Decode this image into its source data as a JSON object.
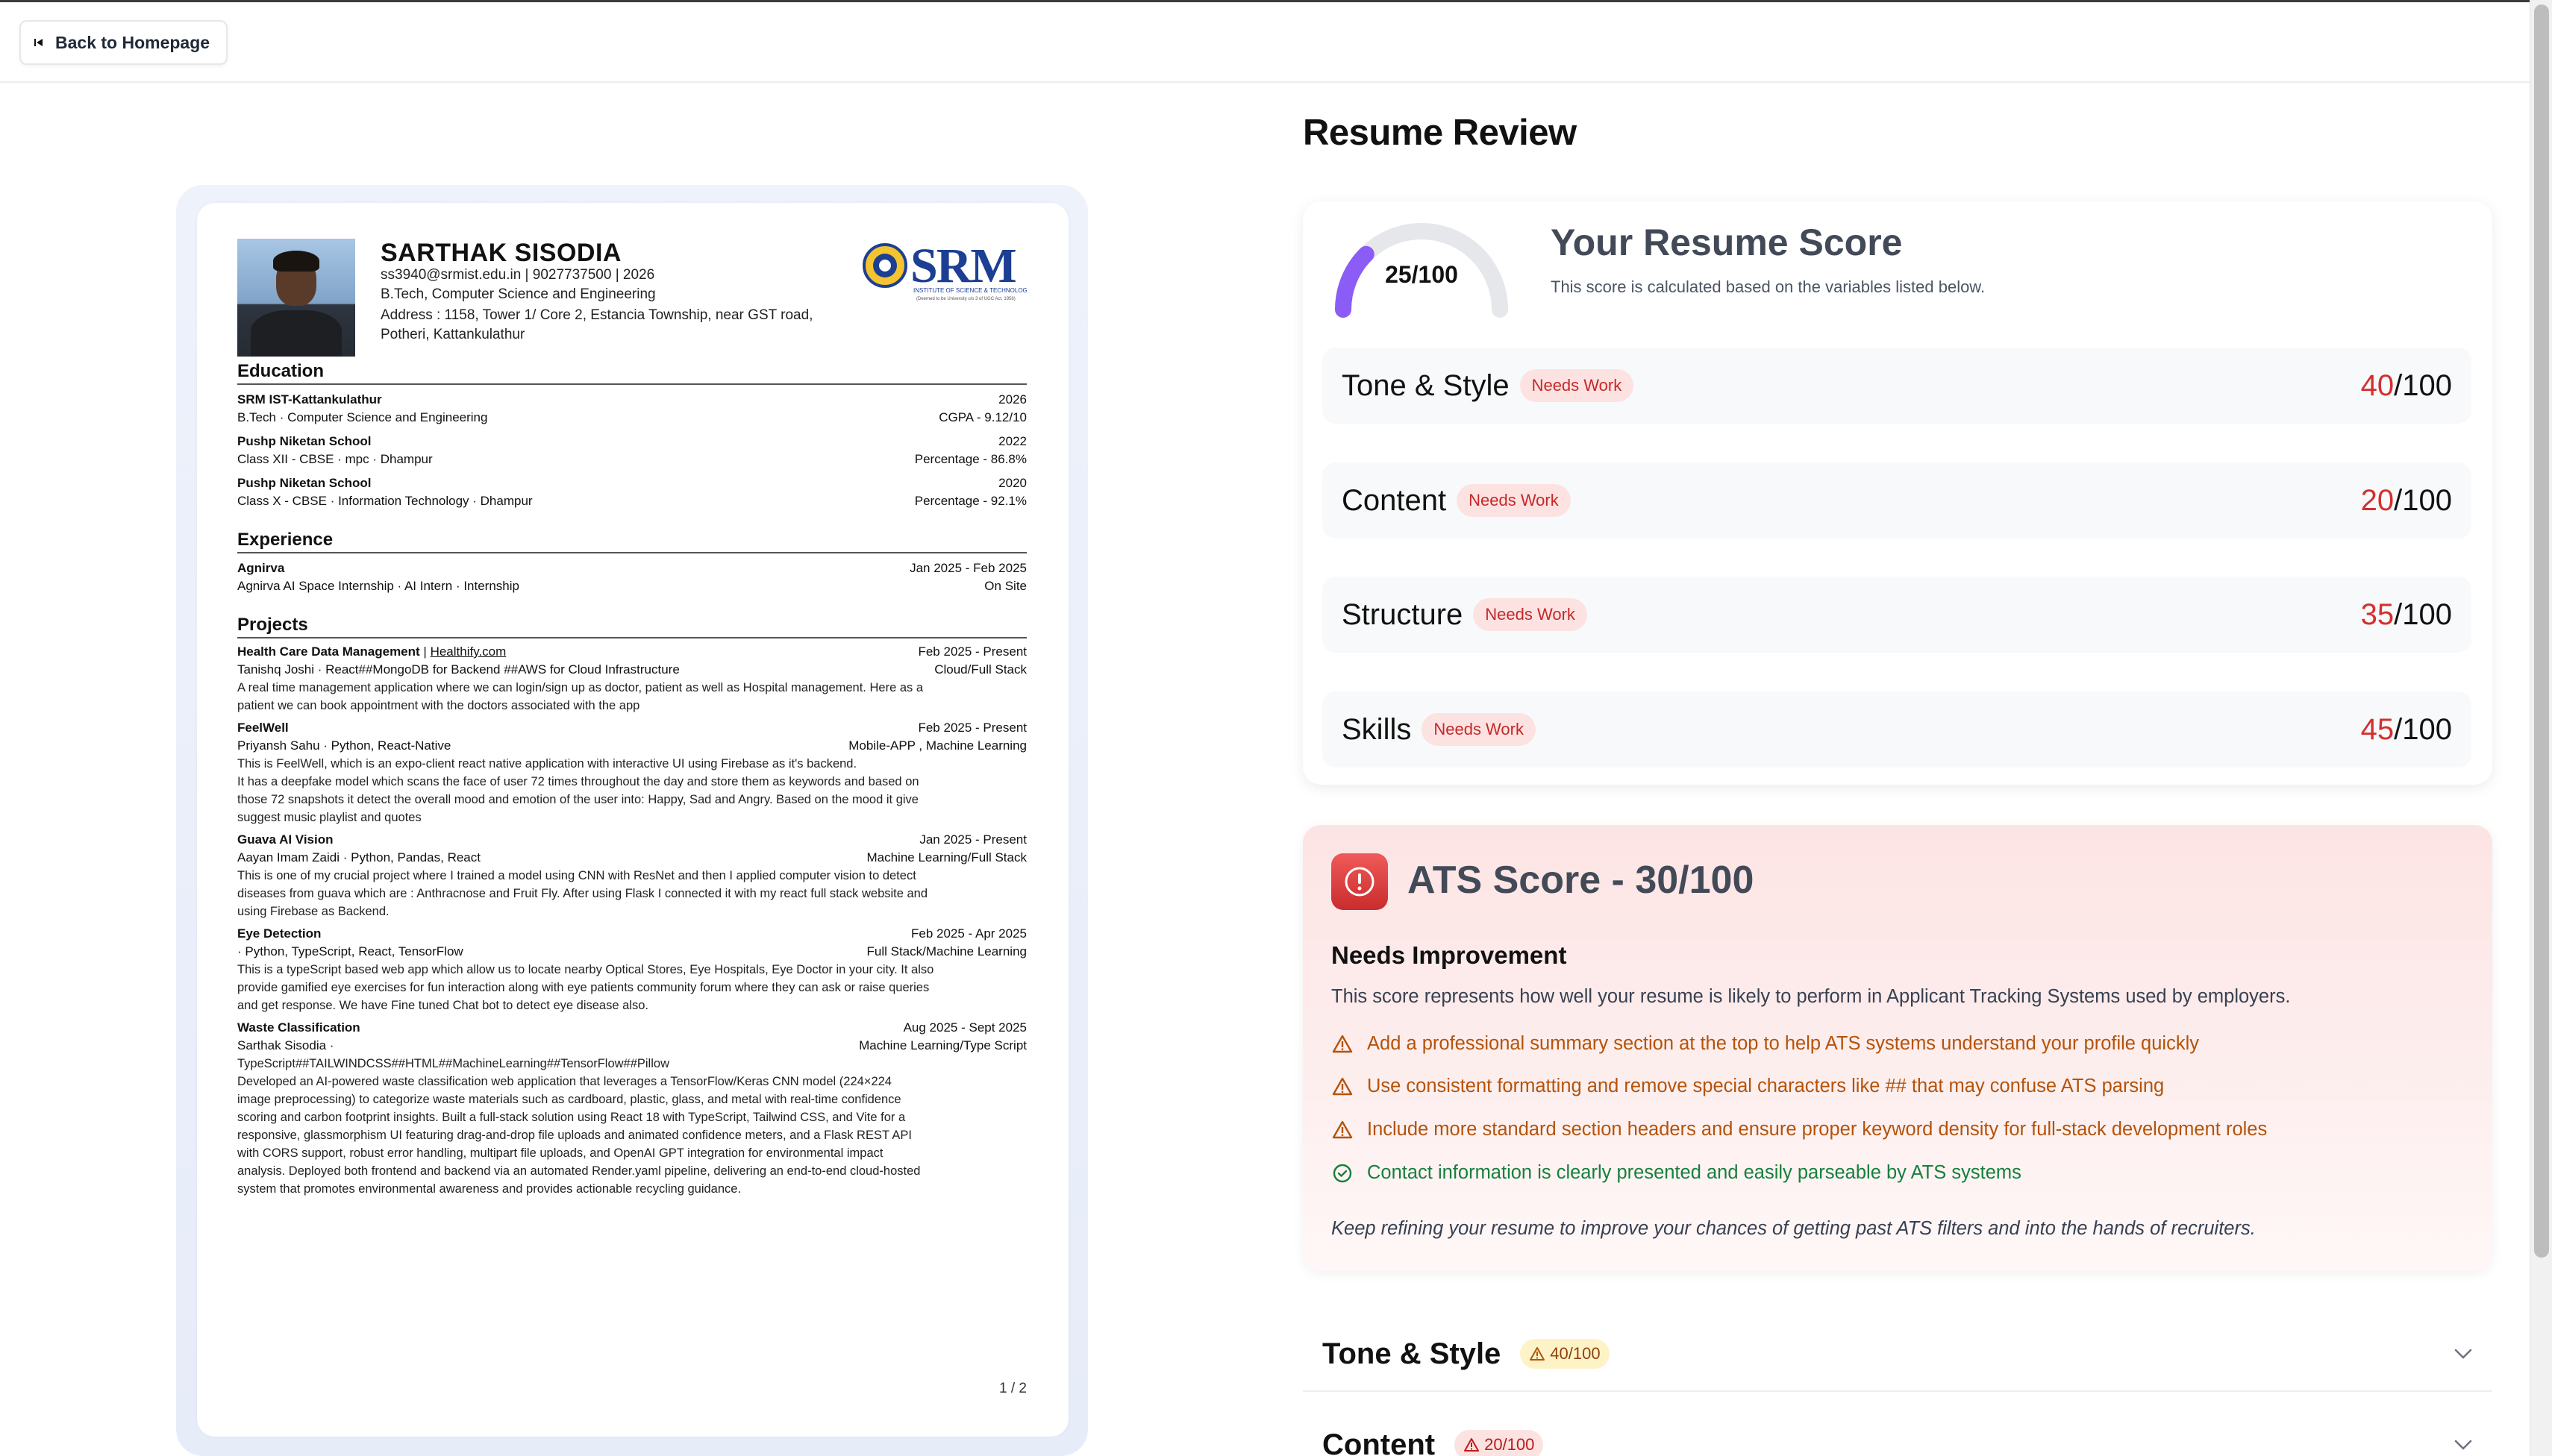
{
  "topbar": {
    "back_label": "Back to Homepage"
  },
  "resume": {
    "name": "SARTHAK SISODIA",
    "contact": "ss3940@srmist.edu.in   |   9027737500   |   2026",
    "degree": "B.Tech, Computer Science and Engineering",
    "address1": "Address : 1158, Tower 1/ Core 2, Estancia Township, near GST road,",
    "address2": "Potheri, Kattankulathur",
    "logo_text": "SRM",
    "logo_sub": "INSTITUTE OF SCIENCE & TECHNOLOGY",
    "logo_sub2": "(Deemed to be University u/s 3 of UGC Act, 1956)",
    "sections": {
      "education": "Education",
      "experience": "Experience",
      "projects": "Projects"
    },
    "education": [
      {
        "school": "SRM IST-Kattankulathur",
        "year": "2026",
        "detail": "B.Tech  ·  Computer Science and Engineering",
        "score": "CGPA - 9.12/10"
      },
      {
        "school": "Pushp Niketan School",
        "year": "2022",
        "detail": "Class XII - CBSE  ·  mpc  ·  Dhampur",
        "score": "Percentage - 86.8%"
      },
      {
        "school": "Pushp Niketan School",
        "year": "2020",
        "detail": "Class X - CBSE  ·  Information Technology  ·  Dhampur",
        "score": "Percentage - 92.1%"
      }
    ],
    "experience": [
      {
        "org": "Agnirva",
        "dates": "Jan 2025 - Feb 2025",
        "detail": "Agnirva AI Space Internship  ·  AI Intern  ·  Internship",
        "location": "On Site"
      }
    ],
    "projects": [
      {
        "title": "Health Care Data Management",
        "sep": "  |  ",
        "link": "Healthify.com",
        "dates": "Feb 2025 - Present",
        "meta": "Tanishq Joshi  ·  React##MongoDB for Backend ##AWS for Cloud Infrastructure",
        "tag": "Cloud/Full Stack",
        "desc": [
          "A real time management application where we can login/sign up as doctor, patient as well as Hospital management. Here as a",
          "patient we can book appointment with the doctors associated with the app"
        ]
      },
      {
        "title": "FeelWell",
        "sep": "",
        "link": "",
        "dates": "Feb 2025 - Present",
        "meta": "Priyansh Sahu  ·  Python, React-Native",
        "tag": "Mobile-APP , Machine Learning",
        "desc": [
          "This is FeelWell, which is an expo-client react native application with interactive UI using Firebase as it's backend.",
          "It has a deepfake model which scans the face of user 72 times throughout the day and store them as keywords and based on",
          "those 72 snapshots it detect the overall mood and emotion of the user into: Happy, Sad and Angry. Based on the mood it give",
          "suggest music playlist and quotes"
        ]
      },
      {
        "title": "Guava AI Vision",
        "sep": "",
        "link": "",
        "dates": "Jan 2025 - Present",
        "meta": "Aayan Imam Zaidi  ·  Python, Pandas, React",
        "tag": "Machine Learning/Full Stack",
        "desc": [
          "This is one of my crucial project where I trained a model using CNN with ResNet and then I applied computer vision to detect",
          "diseases from guava which are : Anthracnose and Fruit Fly. After using Flask I connected it with my react full stack website and",
          "using Firebase as Backend."
        ]
      },
      {
        "title": "Eye Detection",
        "sep": "",
        "link": "",
        "dates": "Feb 2025 - Apr 2025",
        "meta": " ·  Python, TypeScript, React, TensorFlow",
        "tag": "Full Stack/Machine Learning",
        "desc": [
          "This is a typeScript based web app which allow us to locate nearby Optical Stores, Eye Hospitals, Eye Doctor in your city. It also",
          "provide gamified eye exercises for fun interaction along with eye patients community forum where they can ask or raise queries",
          "and get response. We have Fine tuned Chat bot to detect eye disease also."
        ]
      },
      {
        "title": "Waste Classification",
        "sep": "",
        "link": "",
        "dates": "Aug 2025 - Sept 2025",
        "meta": "Sarthak Sisodia  ·",
        "tag": "Machine Learning/Type Script",
        "meta2": "TypeScript##TAILWINDCSS##HTML##MachineLearning##TensorFlow##Pillow",
        "desc": [
          "Developed an AI-powered waste classification web application that leverages a TensorFlow/Keras CNN model (224×224",
          "image preprocessing) to categorize waste materials such as cardboard, plastic, glass, and metal with real-time confidence",
          "scoring and carbon footprint insights. Built a full-stack solution using React 18 with TypeScript, Tailwind CSS, and Vite for a",
          "responsive, glassmorphism UI featuring drag-and-drop file uploads and animated confidence meters, and a Flask REST API",
          "with CORS support, robust error handling, multipart file uploads, and OpenAI GPT integration for environmental impact",
          "analysis. Deployed both frontend and backend via an automated Render.yaml pipeline, delivering an end-to-end cloud-hosted",
          "system that promotes environmental awareness and provides actionable recycling guidance."
        ]
      }
    ],
    "page_indicator": "1 / 2"
  },
  "review": {
    "title": "Resume Review",
    "overall": {
      "score": 25,
      "label": "25/100",
      "heading": "Your Resume Score",
      "subtitle": "This score is calculated based on the variables listed below."
    },
    "categories": [
      {
        "name": "Tone & Style",
        "badge": "Needs Work",
        "value": "40",
        "max": "/100"
      },
      {
        "name": "Content",
        "badge": "Needs Work",
        "value": "20",
        "max": "/100"
      },
      {
        "name": "Structure",
        "badge": "Needs Work",
        "value": "35",
        "max": "/100"
      },
      {
        "name": "Skills",
        "badge": "Needs Work",
        "value": "45",
        "max": "/100"
      }
    ],
    "ats": {
      "title": "ATS Score - 30/100",
      "heading": "Needs Improvement",
      "description": "This score represents how well your resume is likely to perform in Applicant Tracking Systems used by employers.",
      "tips": [
        {
          "type": "warn",
          "text": "Add a professional summary section at the top to help ATS systems understand your profile quickly"
        },
        {
          "type": "warn",
          "text": "Use consistent formatting and remove special characters like ## that may confuse ATS parsing"
        },
        {
          "type": "warn",
          "text": "Include more standard section headers and ensure proper keyword density for full-stack development roles"
        },
        {
          "type": "good",
          "text": "Contact information is clearly presented and easily parseable by ATS systems"
        }
      ],
      "footer": "Keep refining your resume to improve your chances of getting past ATS filters and into the hands of recruiters."
    },
    "accordions": [
      {
        "name": "Tone & Style",
        "badge": "40/100"
      },
      {
        "name": "Content",
        "badge": "20/100"
      }
    ]
  },
  "colors": {
    "accent": "#8b5cf6",
    "danger": "#d32f2f",
    "warning": "#b45309",
    "success": "#15803d"
  }
}
